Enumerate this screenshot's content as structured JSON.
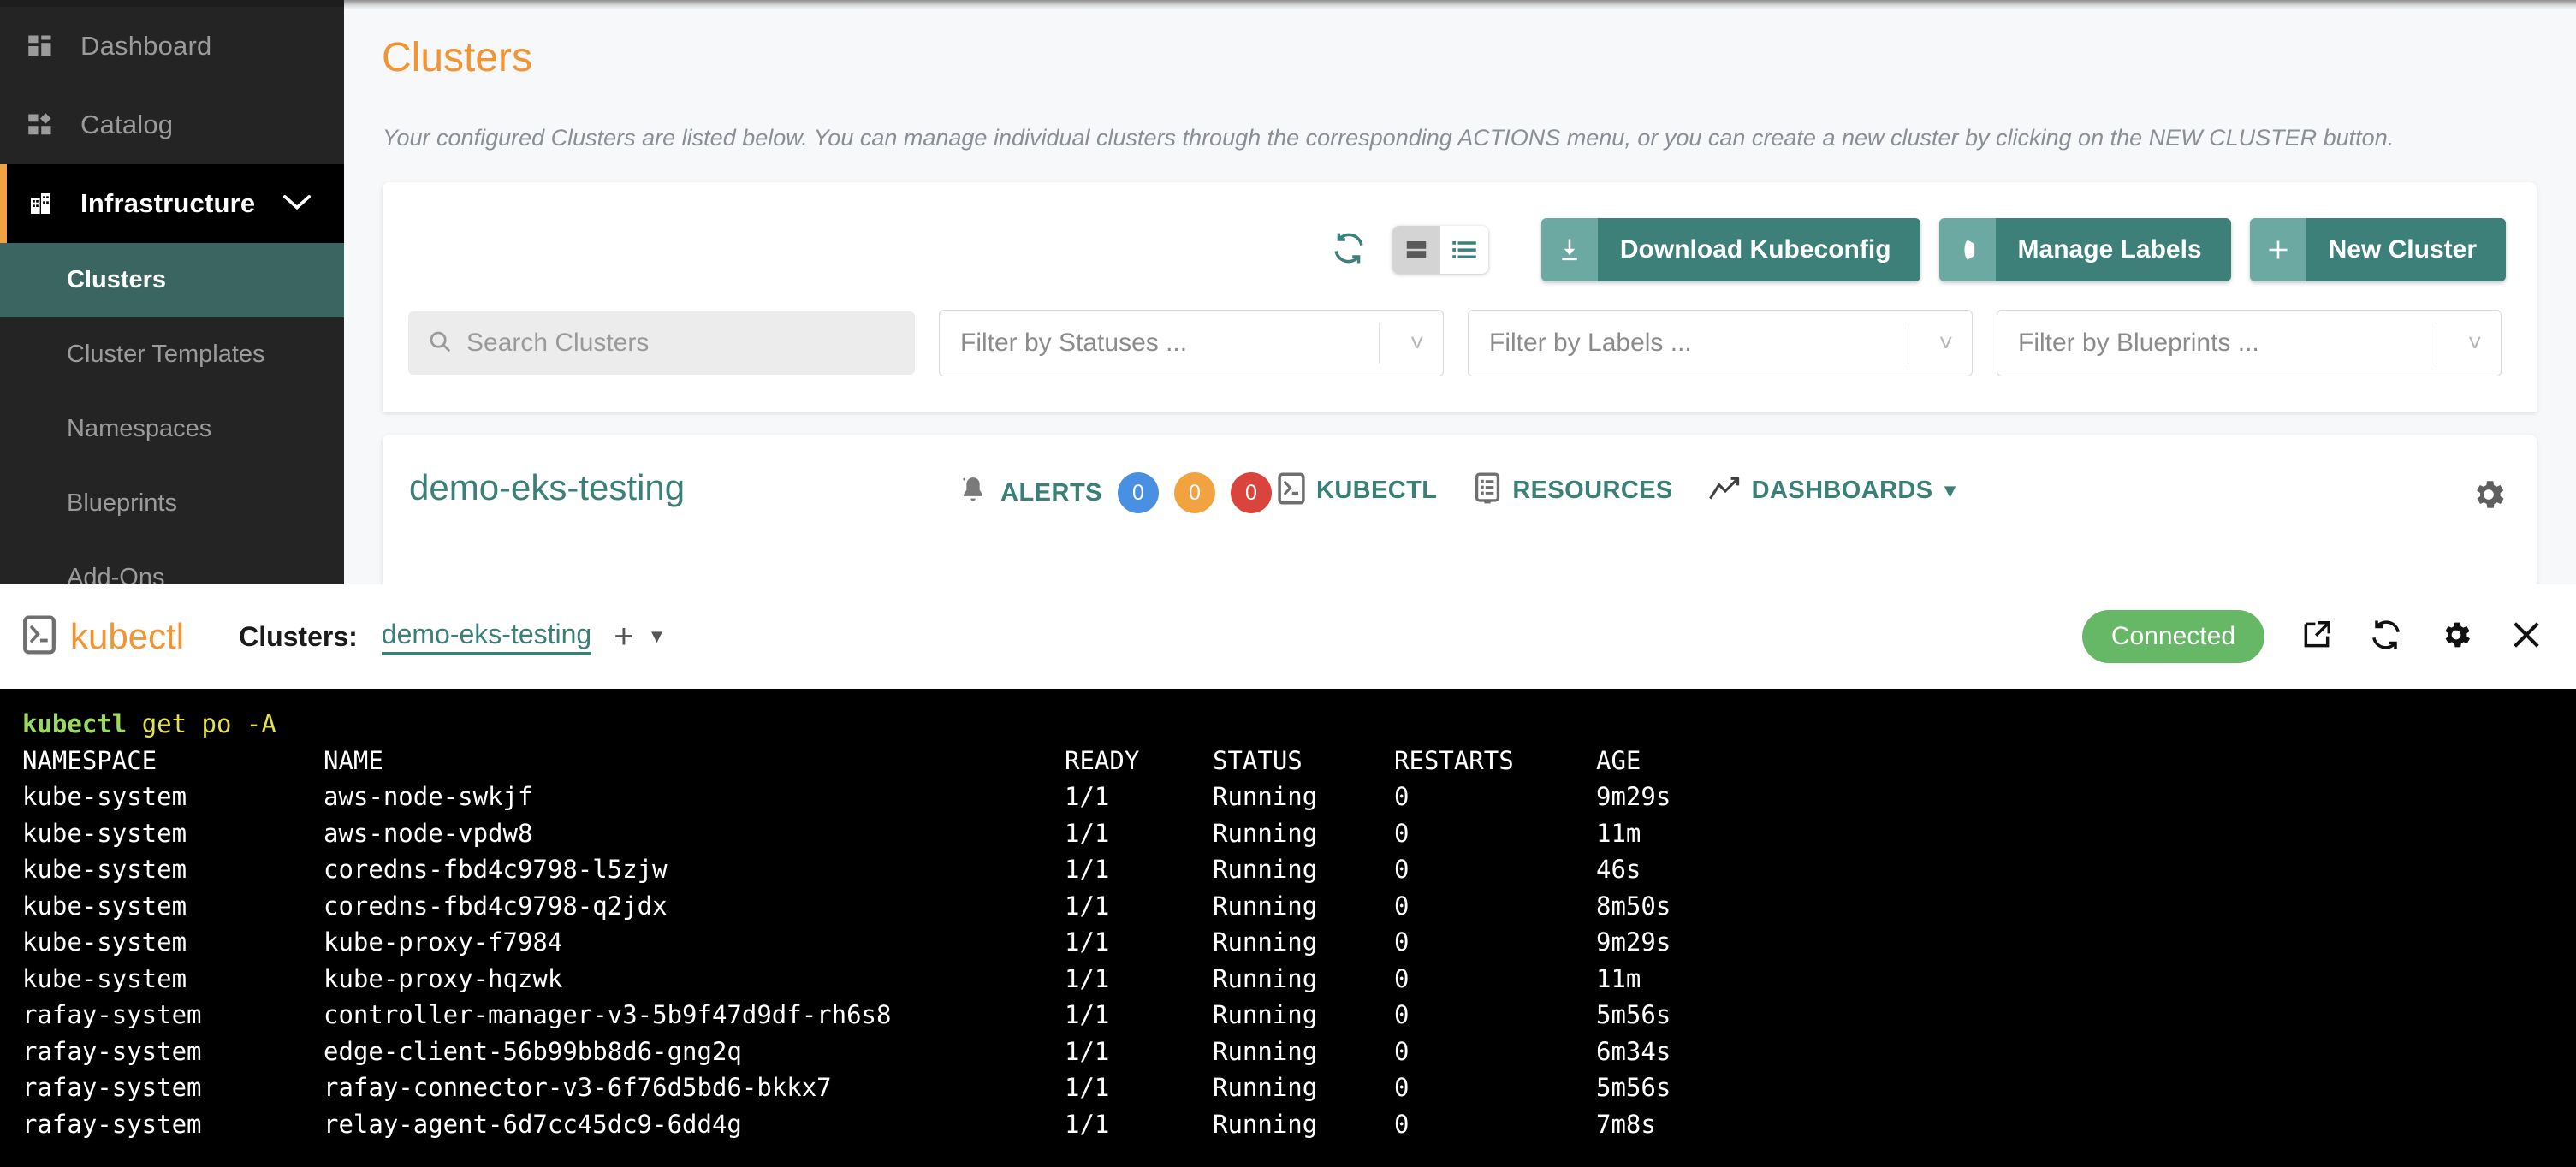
{
  "sidebar": {
    "items": [
      {
        "label": "Dashboard",
        "icon": "dashboard-grid-icon"
      },
      {
        "label": "Catalog",
        "icon": "catalog-grid-icon"
      },
      {
        "label": "Infrastructure",
        "icon": "building-icon",
        "expanded": true,
        "chevron": "⌄"
      }
    ],
    "sub_items": [
      {
        "label": "Clusters",
        "active": true
      },
      {
        "label": "Cluster Templates",
        "active": false
      },
      {
        "label": "Namespaces",
        "active": false
      },
      {
        "label": "Blueprints",
        "active": false
      },
      {
        "label": "Add-Ons",
        "active": false
      }
    ]
  },
  "page": {
    "title": "Clusters",
    "description": "Your configured Clusters are listed below. You can manage individual clusters through the corresponding ACTIONS menu, or you can create a new cluster by clicking on the NEW CLUSTER button."
  },
  "toolbar": {
    "refresh_icon": "refresh-icon",
    "view_card_icon": "card-view-icon",
    "view_list_icon": "list-view-icon",
    "buttons": [
      {
        "label": "Download Kubeconfig",
        "icon": "download-icon"
      },
      {
        "label": "Manage Labels",
        "icon": "tag-icon"
      },
      {
        "label": "New Cluster",
        "icon": "plus-icon"
      }
    ]
  },
  "filters": {
    "search_placeholder": "Search Clusters",
    "search_value": "",
    "search_icon": "search-icon",
    "selects": [
      {
        "placeholder": "Filter by Statuses ...",
        "value": ""
      },
      {
        "placeholder": "Filter by Labels ...",
        "value": ""
      },
      {
        "placeholder": "Filter by Blueprints ...",
        "value": ""
      }
    ]
  },
  "cluster_row": {
    "name": "demo-eks-testing",
    "alerts_label": "ALERTS",
    "alerts_icon": "bell-icon",
    "badges": [
      {
        "count": "0",
        "color": "#4A90E2"
      },
      {
        "count": "0",
        "color": "#F0A340"
      },
      {
        "count": "0",
        "color": "#D9453C"
      }
    ],
    "actions": [
      {
        "label": "KUBECTL",
        "icon": "terminal-icon"
      },
      {
        "label": "RESOURCES",
        "icon": "resources-icon"
      },
      {
        "label": "DASHBOARDS",
        "icon": "trend-up-icon",
        "caret": "▾"
      }
    ],
    "settings_icon": "gear-icon"
  },
  "kubectl": {
    "logo_text": "kubectl",
    "logo_icon": "terminal-icon",
    "clusters_label": "Clusters:",
    "selected_cluster": "demo-eks-testing",
    "add_tab_icon": "plus-icon",
    "tab_caret_icon": "chevron-down-icon",
    "status": "Connected",
    "status_color": "#66B866",
    "header_icons": [
      {
        "name": "open-external-icon"
      },
      {
        "name": "refresh-icon"
      },
      {
        "name": "gear-icon"
      },
      {
        "name": "close-icon"
      }
    ],
    "command": {
      "program": "kubectl",
      "args": "get po -A"
    },
    "columns": [
      "NAMESPACE",
      "NAME",
      "READY",
      "STATUS",
      "RESTARTS",
      "AGE"
    ],
    "rows": [
      [
        "kube-system",
        "aws-node-swkjf",
        "1/1",
        "Running",
        "0",
        "9m29s"
      ],
      [
        "kube-system",
        "aws-node-vpdw8",
        "1/1",
        "Running",
        "0",
        "11m"
      ],
      [
        "kube-system",
        "coredns-fbd4c9798-l5zjw",
        "1/1",
        "Running",
        "0",
        "46s"
      ],
      [
        "kube-system",
        "coredns-fbd4c9798-q2jdx",
        "1/1",
        "Running",
        "0",
        "8m50s"
      ],
      [
        "kube-system",
        "kube-proxy-f7984",
        "1/1",
        "Running",
        "0",
        "9m29s"
      ],
      [
        "kube-system",
        "kube-proxy-hqzwk",
        "1/1",
        "Running",
        "0",
        "11m"
      ],
      [
        "rafay-system",
        "controller-manager-v3-5b9f47d9df-rh6s8",
        "1/1",
        "Running",
        "0",
        "5m56s"
      ],
      [
        "rafay-system",
        "edge-client-56b99bb8d6-gng2q",
        "1/1",
        "Running",
        "0",
        "6m34s"
      ],
      [
        "rafay-system",
        "rafay-connector-v3-6f76d5bd6-bkkx7",
        "1/1",
        "Running",
        "0",
        "5m56s"
      ],
      [
        "rafay-system",
        "relay-agent-6d7cc45dc9-6dd4g",
        "1/1",
        "Running",
        "0",
        "7m8s"
      ]
    ]
  },
  "colors": {
    "brand_orange": "#F29434",
    "teal_dark": "#3D8079",
    "teal_light": "#6CA9A2",
    "sidebar_bg": "#242424",
    "active_sub_bg": "#3A6560",
    "main_bg": "#F7F8FA"
  }
}
